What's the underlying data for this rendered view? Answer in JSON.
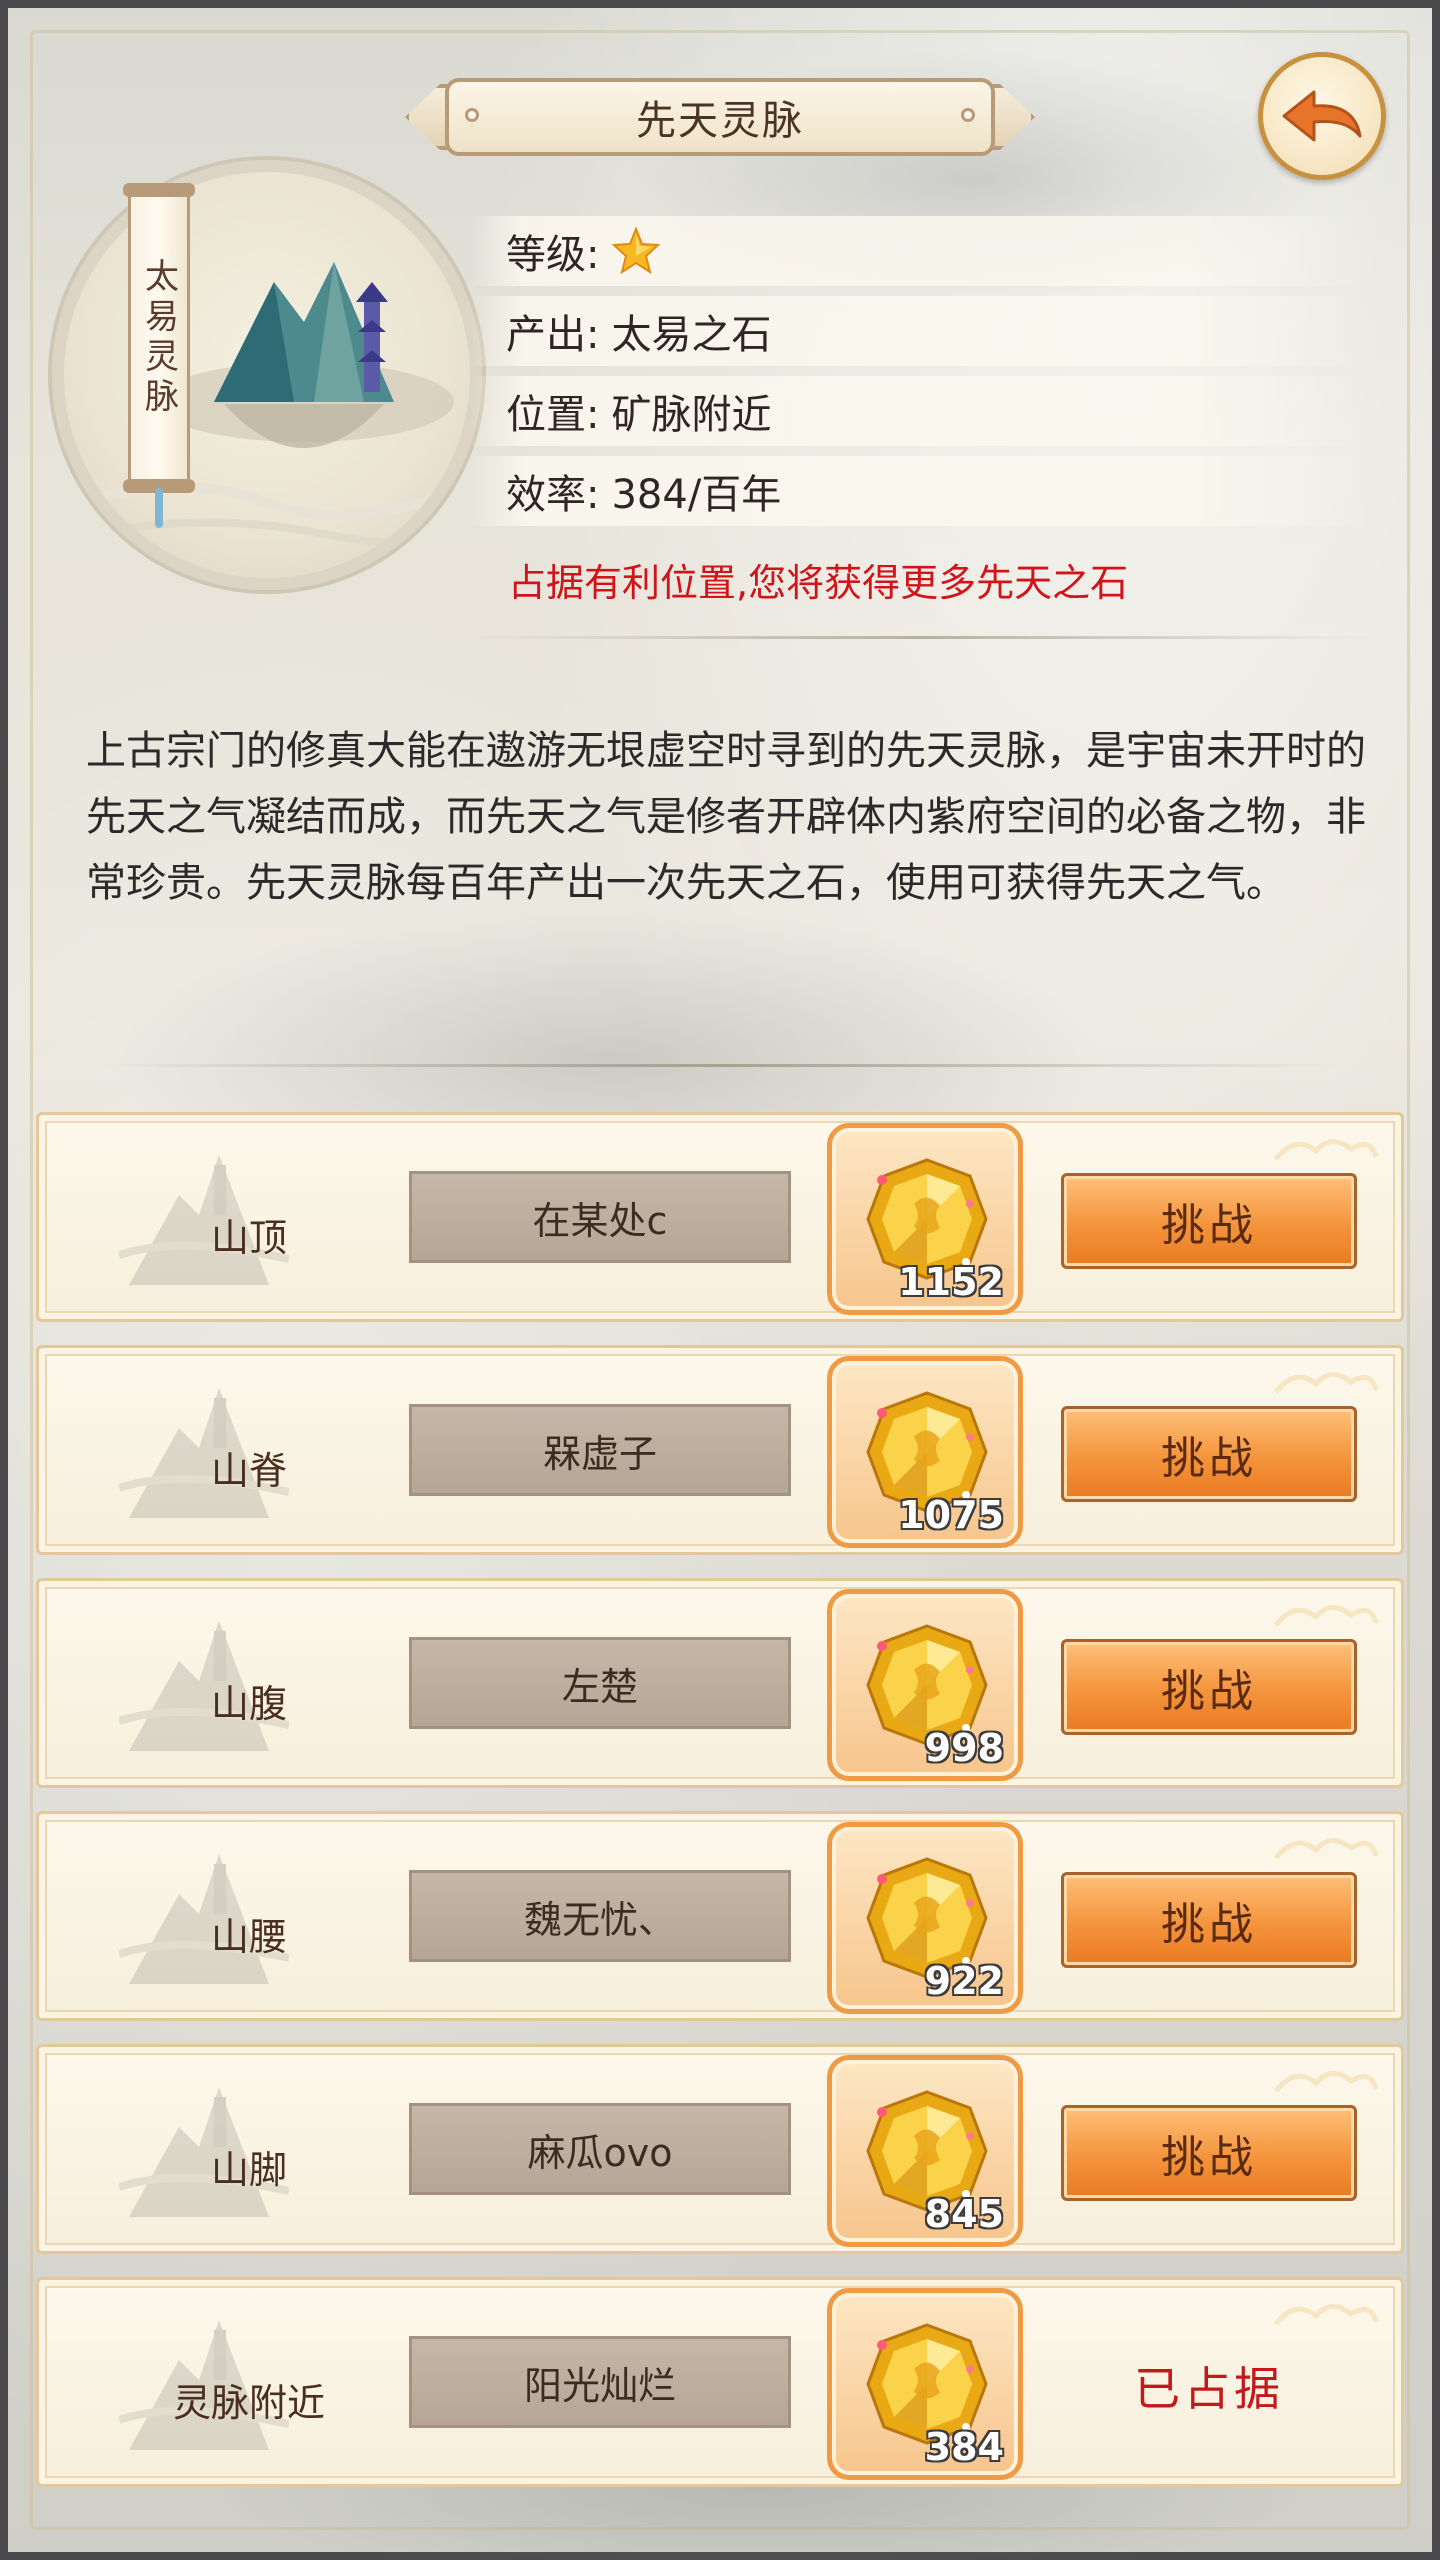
{
  "header": {
    "title": "先天灵脉"
  },
  "emblem": {
    "scroll_text": "太易灵脉"
  },
  "info": {
    "level_label": "等级:",
    "output_label": "产出:",
    "output_value": "太易之石",
    "location_label": "位置:",
    "location_value": "矿脉附近",
    "efficiency_label": "效率:",
    "efficiency_value": "384/百年",
    "note": "占据有利位置,您将获得更多先天之石"
  },
  "description": "上古宗门的修真大能在遨游无垠虚空时寻到的先天灵脉，是宇宙未开时的先天之气凝结而成，而先天之气是修者开辟体内紫府空间的必备之物，非常珍贵。先天灵脉每百年产出一次先天之石，使用可获得先天之气。",
  "positions": [
    {
      "name": "山顶",
      "occupant": "在某处c",
      "reward": "1152",
      "action": "挑战"
    },
    {
      "name": "山脊",
      "occupant": "槑虚子",
      "reward": "1075",
      "action": "挑战"
    },
    {
      "name": "山腹",
      "occupant": "左楚",
      "reward": "998",
      "action": "挑战"
    },
    {
      "name": "山腰",
      "occupant": "魏无忧、",
      "reward": "922",
      "action": "挑战"
    },
    {
      "name": "山脚",
      "occupant": "麻瓜ovo",
      "reward": "845",
      "action": "挑战"
    },
    {
      "name": "灵脉附近",
      "occupant": "阳光灿烂",
      "reward": "384",
      "status": "已占据"
    }
  ],
  "colors": {
    "accent_orange": "#f4943c",
    "note_red": "#d0141a",
    "occupied_red": "#c4181b"
  },
  "icons": {
    "back": "back-arrow-icon",
    "level": "star-icon",
    "reward": "gold-gem-icon"
  }
}
